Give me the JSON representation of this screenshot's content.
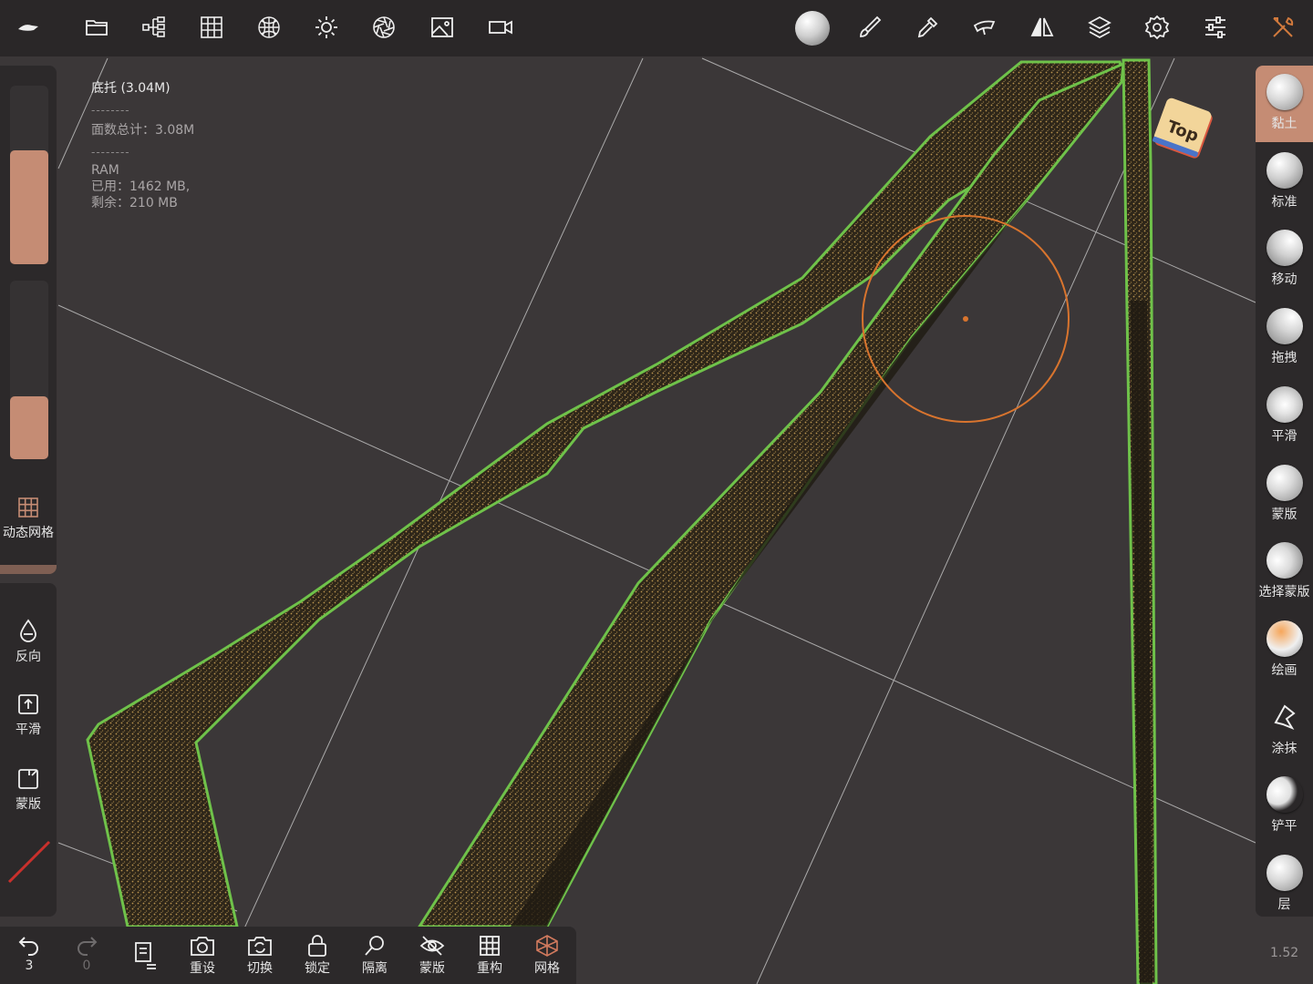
{
  "stats": {
    "object": "底托 (3.04M)",
    "divider": "--------",
    "faces": "面数总计：3.08M",
    "ram_label": "RAM",
    "used": "已用：1462 MB,",
    "free": "剩余：210 MB"
  },
  "top_toolbar": {
    "left_icons": [
      "app-logo-icon",
      "folder-icon",
      "scene-tree-icon",
      "grid-icon",
      "topology-icon",
      "light-icon",
      "material-icon",
      "image-icon",
      "video-icon"
    ],
    "right_icons": [
      "matcap-sphere-icon",
      "brush-icon",
      "picker-icon",
      "stroke-icon",
      "symmetry-icon",
      "layers-icon",
      "settings-icon",
      "sliders-icon",
      "tools-icon"
    ]
  },
  "left_panel": {
    "dynamic_mesh": "动态网格",
    "invert": "反向",
    "smooth": "平滑",
    "mask": "蒙版",
    "size_fill": 0.64,
    "intensity_fill": 0.35
  },
  "right_tools": [
    {
      "label": "黏土",
      "active": true
    },
    {
      "label": "标准",
      "active": false
    },
    {
      "label": "移动",
      "active": false
    },
    {
      "label": "拖拽",
      "active": false
    },
    {
      "label": "平滑",
      "active": false
    },
    {
      "label": "蒙版",
      "active": false
    },
    {
      "label": "选择蒙版",
      "active": false
    },
    {
      "label": "绘画",
      "active": false
    },
    {
      "label": "涂抹",
      "active": false
    },
    {
      "label": "铲平",
      "active": false
    },
    {
      "label": "层",
      "active": false
    }
  ],
  "bottom_bar": {
    "undo_count": "3",
    "redo_count": "0",
    "reset": "重设",
    "switch": "切换",
    "lock": "锁定",
    "isolate": "隔离",
    "mask": "蒙版",
    "remesh": "重构",
    "mesh": "网格"
  },
  "view_cube": "Top",
  "zoom": "1.52",
  "colors": {
    "background": "#3b3738",
    "accent": "#c58c74",
    "outline": "#6fc24a",
    "brush_circle": "#d8742e"
  }
}
